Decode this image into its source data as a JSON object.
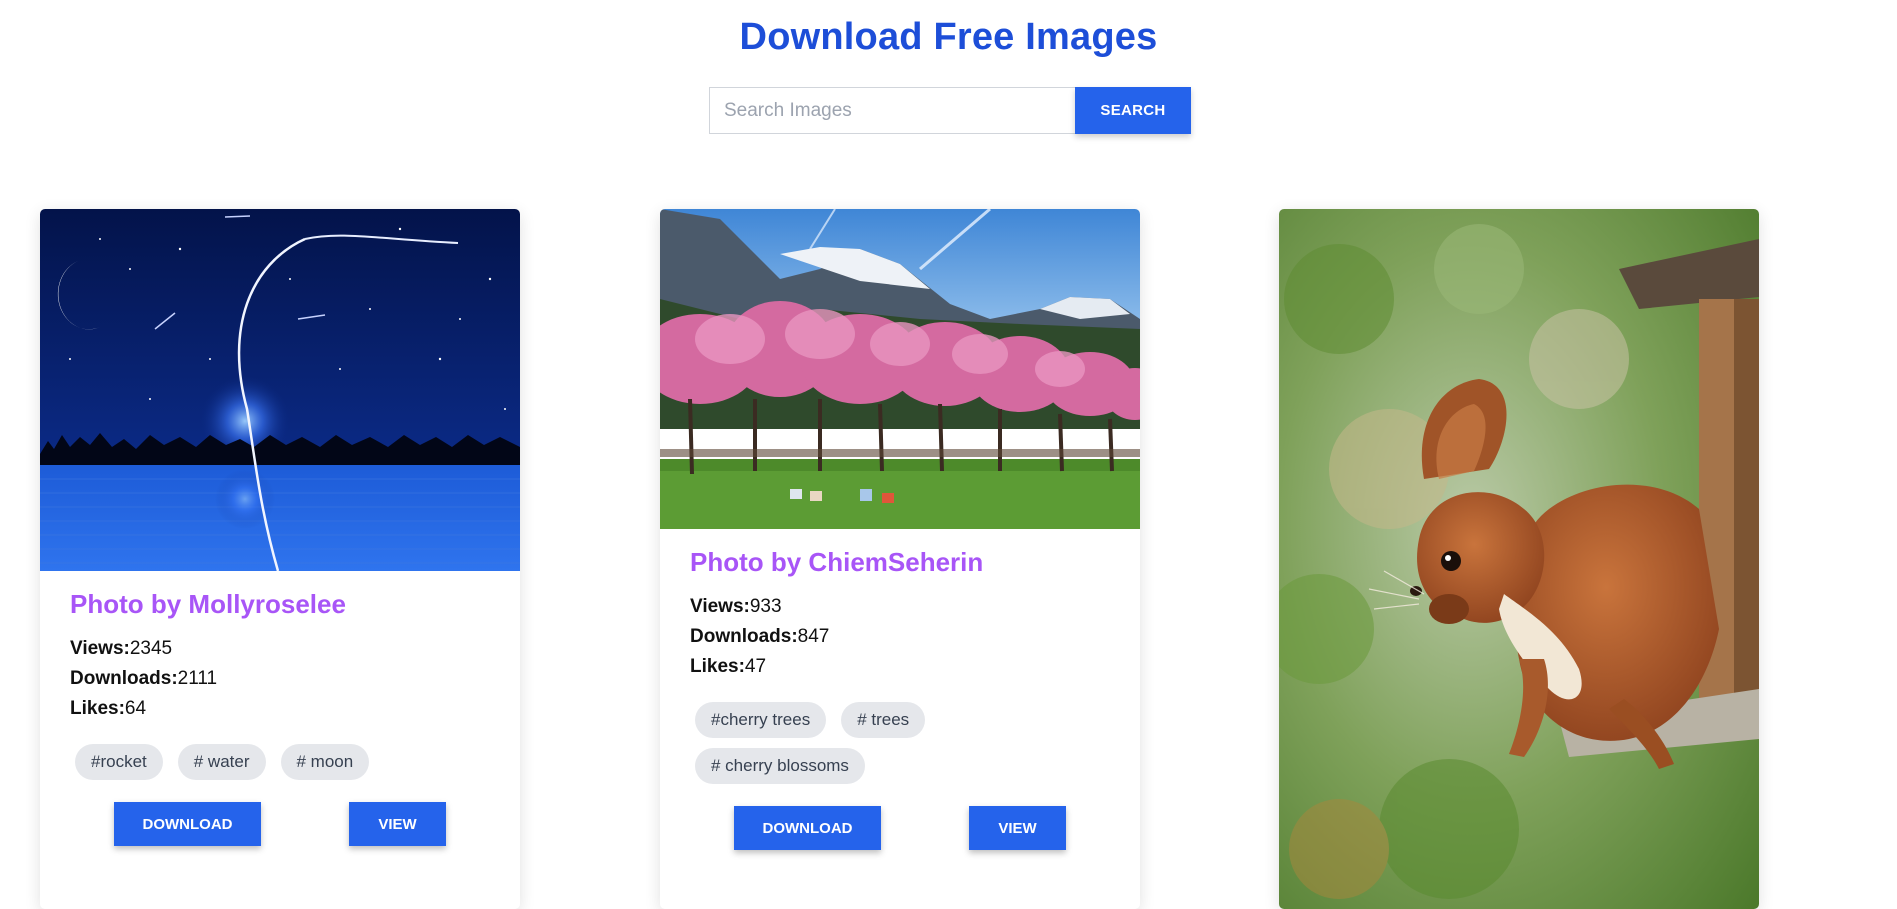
{
  "header": {
    "title": "Download Free Images"
  },
  "search": {
    "placeholder": "Search Images",
    "value": "",
    "button_label": "SEARCH"
  },
  "colors": {
    "accent": "#2563eb",
    "title": "#1d4ed8",
    "card_title": "#a855f7",
    "tag_bg": "#e5e7eb"
  },
  "cards": [
    {
      "title": "Photo by Mollyroselee",
      "views_label": "Views:",
      "views": "2345",
      "downloads_label": "Downloads:",
      "downloads": "2111",
      "likes_label": "Likes:",
      "likes": "64",
      "tags": [
        "#rocket",
        "# water",
        "# moon"
      ],
      "download_label": "DOWNLOAD",
      "view_label": "VIEW"
    },
    {
      "title": "Photo by ChiemSeherin",
      "views_label": "Views:",
      "views": "933",
      "downloads_label": "Downloads:",
      "downloads": "847",
      "likes_label": "Likes:",
      "likes": "47",
      "tags": [
        "#cherry trees",
        "# trees",
        "# cherry blossoms"
      ],
      "download_label": "DOWNLOAD",
      "view_label": "VIEW"
    },
    {
      "title": "",
      "tags": []
    }
  ]
}
